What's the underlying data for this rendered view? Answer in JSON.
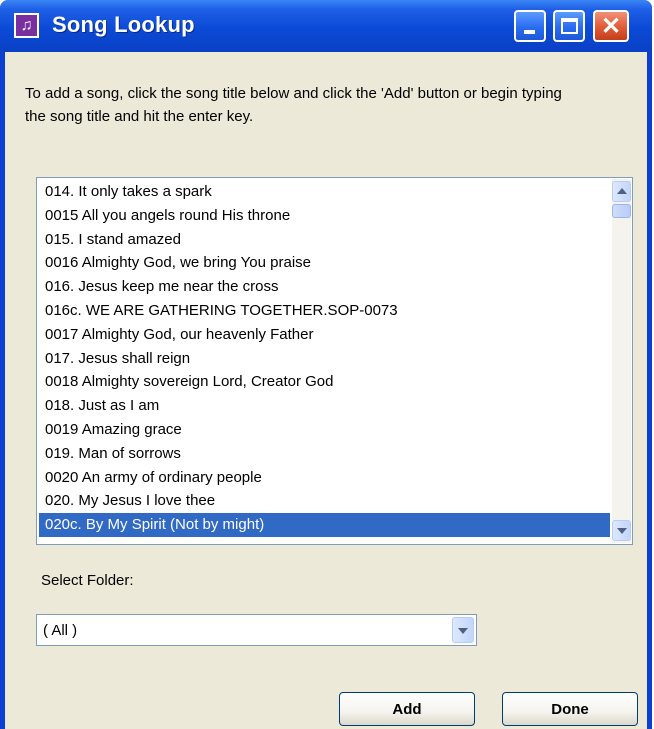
{
  "window": {
    "title": "Song Lookup",
    "app_icon_glyph": "♫"
  },
  "titlebar_buttons": {
    "close_glyph": "✕"
  },
  "instructions": "To add a song, click the song title below and click the 'Add' button or begin typing the song title and hit the enter key.",
  "song_list": {
    "items": [
      "014. It only takes a spark",
      "0015 All you angels round His throne",
      "015. I stand amazed",
      "0016 Almighty God, we bring You praise",
      "016. Jesus keep me near the cross",
      "016c. WE ARE GATHERING TOGETHER.SOP-0073",
      "0017 Almighty God, our heavenly Father",
      "017. Jesus shall reign",
      "0018 Almighty sovereign Lord, Creator God",
      "018. Just as I am",
      "0019 Amazing grace",
      "019. Man of sorrows",
      "0020 An army of ordinary people",
      "020. My Jesus I love thee",
      "020c. By My Spirit (Not by might)"
    ],
    "selected_index": 14
  },
  "folder": {
    "label": "Select Folder:",
    "selected": "( All )"
  },
  "buttons": {
    "add": "Add",
    "done": "Done"
  },
  "colors": {
    "titlebar": "#0b4ad6",
    "selection": "#316ac5",
    "dialog_bg": "#ece9d8"
  }
}
